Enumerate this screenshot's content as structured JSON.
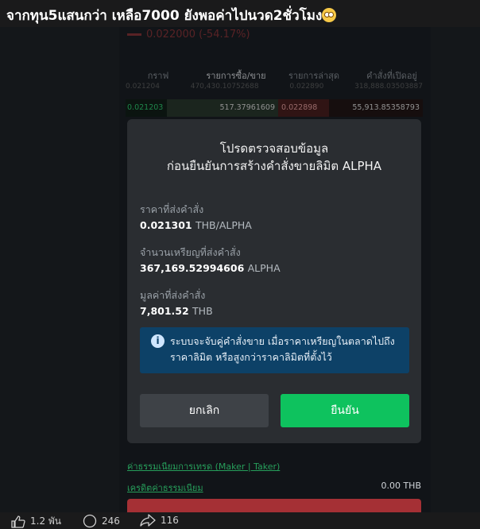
{
  "post": {
    "title": "จากทุน5แสนกว่า เหลือ7000 ยังพอค่าไปนวด2ชั่วโมง",
    "emoji": "flushed-face-emoji"
  },
  "app": {
    "price": "0.022000",
    "price_change": "(-54.17%)",
    "tabs": [
      "กราฟ",
      "รายการซื้อ/ขาย",
      "รายการล่าสุด",
      "คำสั่งที่เปิดอยู่"
    ],
    "active_tab": 1,
    "orderbook_row_top": [
      "0.021204",
      "470,430.10752688",
      "0.022890",
      "318,888.03503887"
    ],
    "orderbook_row": [
      "0.021203",
      "517.37961609",
      "0.022898",
      "55,913.85358793"
    ],
    "fee_link": "ค่าธรรมเนียมการเทรด (Maker | Taker)",
    "credit_label": "เครดิตค่าธรรมเนียม",
    "credit_value": "0.00 THB"
  },
  "modal": {
    "title_line1": "โปรดตรวจสอบข้อมูล",
    "title_line2": "ก่อนยืนยันการสร้างคำสั่งขายลิมิต ALPHA",
    "price_label": "ราคาที่ส่งคำสั่ง",
    "price_value": "0.021301",
    "price_unit": "THB/ALPHA",
    "amount_label": "จำนวนเหรียญที่ส่งคำสั่ง",
    "amount_value": "367,169.52994606",
    "amount_unit": "ALPHA",
    "total_label": "มูลค่าที่ส่งคำสั่ง",
    "total_value": "7,801.52",
    "total_unit": "THB",
    "notice_line1": "ระบบจะจับคู่คำสั่งขาย เมื่อราคาเหรียญในตลาดไปถึง",
    "notice_line2": "ราคาลิมิต หรือสูงกว่าราคาลิมิตที่ตั้งไว้",
    "cancel_label": "ยกเลิก",
    "confirm_label": "ยืนยัน"
  },
  "stats": {
    "likes": "1.2 พัน",
    "comments": "246",
    "shares": "116"
  },
  "colors": {
    "confirm": "#0ec25e",
    "notice_bg": "#0d4167",
    "negative": "#e0474c"
  }
}
